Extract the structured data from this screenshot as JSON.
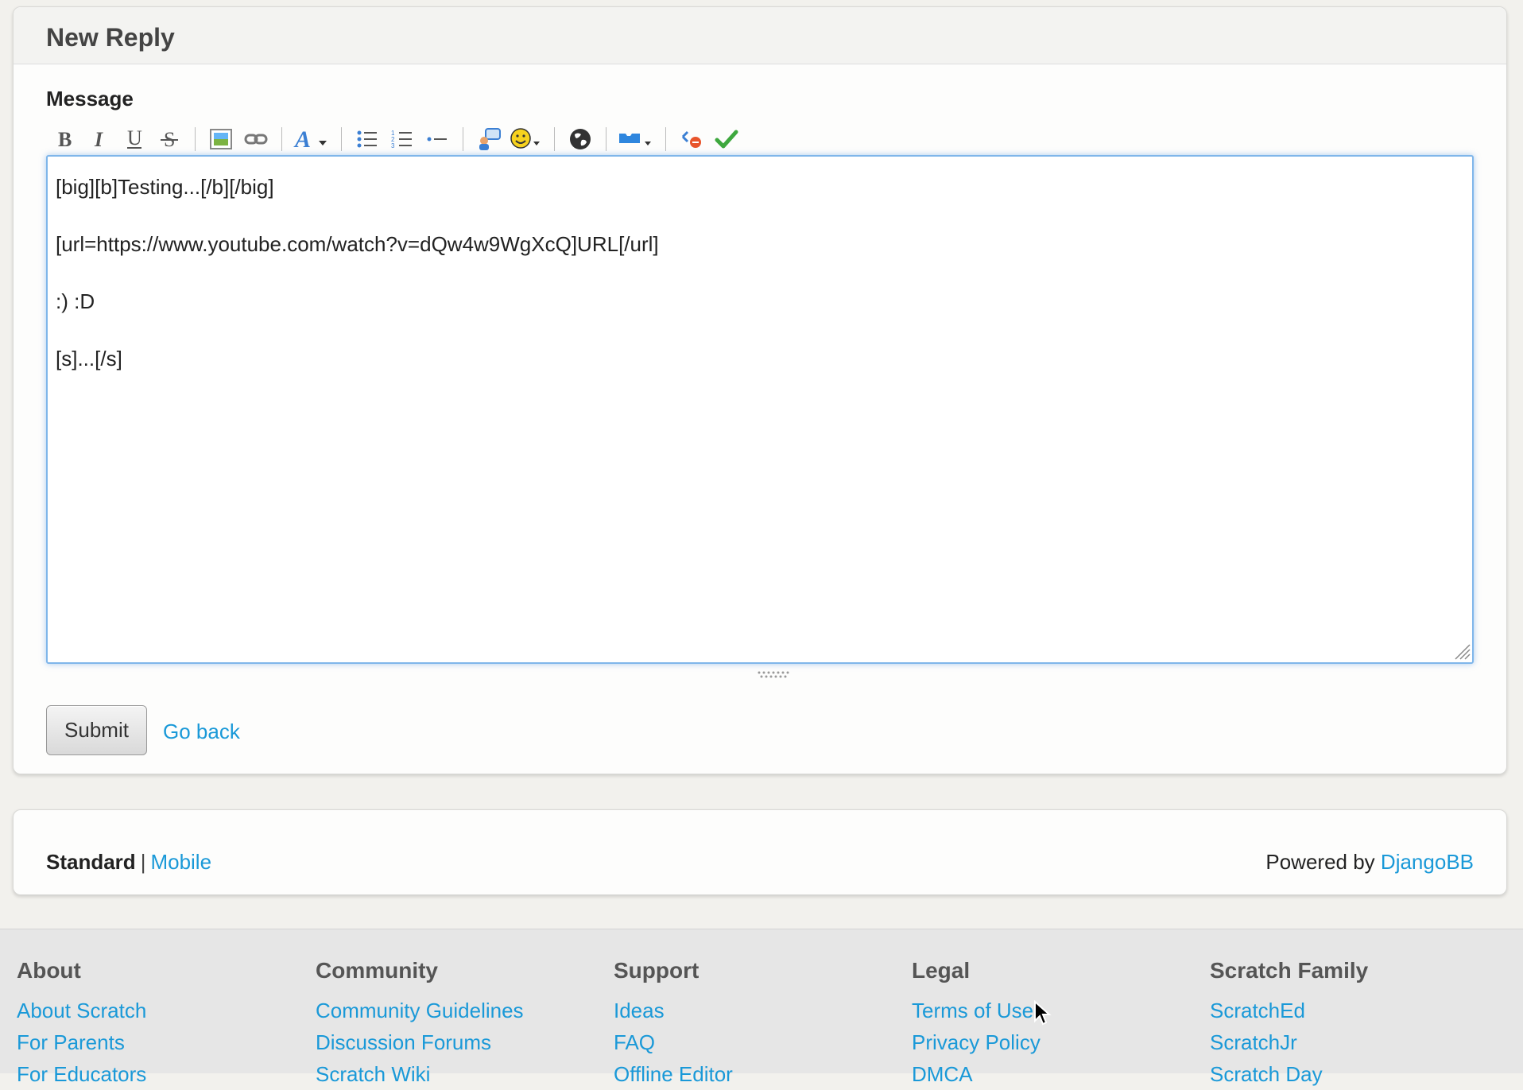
{
  "reply": {
    "title": "New Reply",
    "message_label": "Message",
    "message_text": "[big][b]Testing...[/b][/big]\n\n[url=https://www.youtube.com/watch?v=dQw4w9WgXcQ]URL[/url]\n\n:) :D\n\n[s]...[/s]",
    "submit_label": "Submit",
    "go_back_label": "Go back"
  },
  "toolbar": {
    "icons": [
      "bold-icon",
      "italic-icon",
      "underline-icon",
      "strikethrough-icon",
      "image-icon",
      "link-icon",
      "font-size-icon",
      "bulleted-list-icon",
      "numbered-list-icon",
      "list-item-icon",
      "quote-icon",
      "smiley-icon",
      "globe-icon",
      "scratchblocks-icon",
      "clean-icon",
      "preview-icon"
    ]
  },
  "footer_bar": {
    "standard_label": "Standard",
    "separator": "|",
    "mobile_label": "Mobile",
    "powered_by": "Powered by",
    "djangobb_label": "DjangoBB"
  },
  "site_footer": {
    "columns": [
      {
        "heading": "About",
        "links": [
          "About Scratch",
          "For Parents",
          "For Educators"
        ]
      },
      {
        "heading": "Community",
        "links": [
          "Community Guidelines",
          "Discussion Forums",
          "Scratch Wiki"
        ]
      },
      {
        "heading": "Support",
        "links": [
          "Ideas",
          "FAQ",
          "Offline Editor"
        ]
      },
      {
        "heading": "Legal",
        "links": [
          "Terms of Use",
          "Privacy Policy",
          "DMCA"
        ]
      },
      {
        "heading": "Scratch Family",
        "links": [
          "ScratchEd",
          "ScratchJr",
          "Scratch Day"
        ]
      }
    ]
  },
  "colors": {
    "link": "#1a99d8",
    "focus_border": "#7fb6ea"
  }
}
